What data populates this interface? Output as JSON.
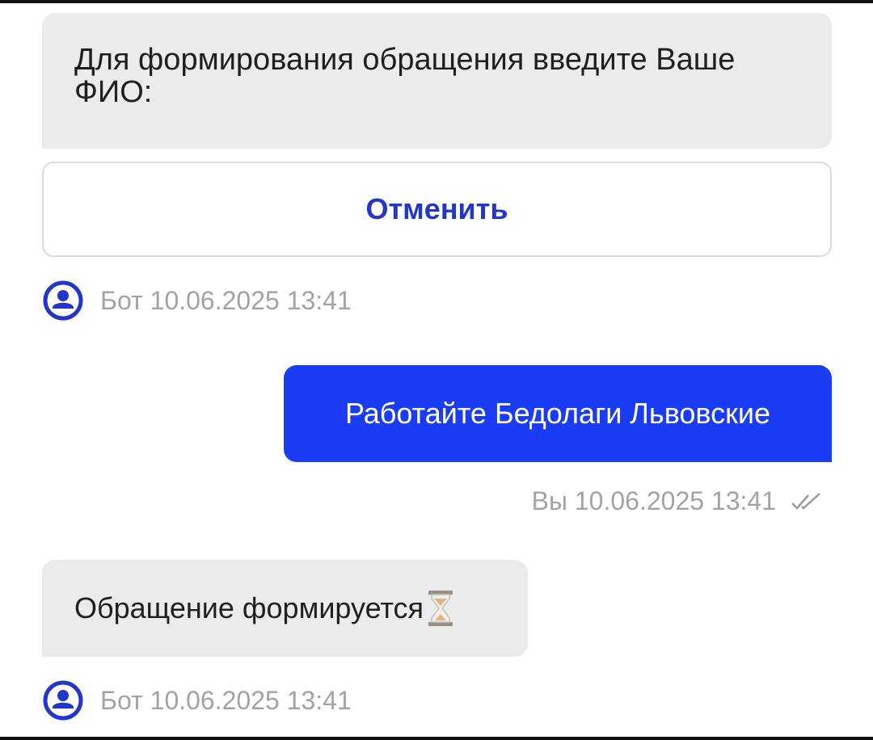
{
  "messages": {
    "bot_prompt": "Для формирования обращения введите Ваше ФИО:",
    "cancel_label": "Отменить",
    "bot_meta_1": "Бот 10.06.2025 13:41",
    "user_message": "Работайте Бедолаги Львовские",
    "user_meta": "Вы 10.06.2025 13:41",
    "bot_status": "Обращение формируется",
    "bot_meta_2": "Бот 10.06.2025 13:41"
  },
  "icons": {
    "avatar": "user-circle-icon",
    "read_status": "double-check-icon",
    "pending": "hourglass-icon"
  },
  "colors": {
    "accent": "#1b3cf5",
    "button_text": "#2236c9",
    "bot_bubble": "#ebebeb",
    "meta_text": "#a3a3a3"
  }
}
